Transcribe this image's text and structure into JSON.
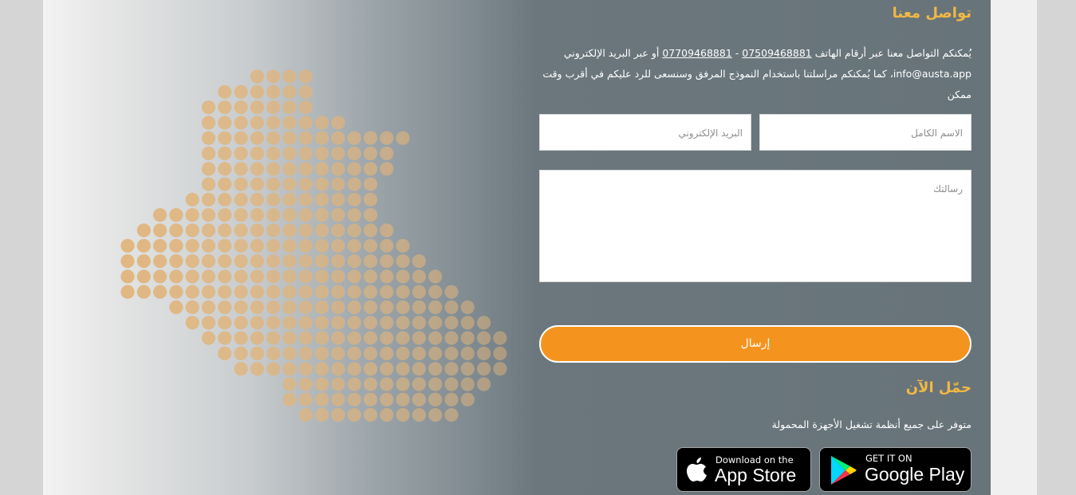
{
  "contact": {
    "title": "تواصل معنا",
    "desc_prefix": "يُمكنكم التواصل معنا عبر أرقام الهاتف ",
    "phone1": "07509468881",
    "separator": " - ",
    "phone2": "07709468881",
    "desc_middle": " أو عبر البريد الإلكتروني ",
    "email": "info@austa.app",
    "desc_suffix": "، كما يُمكنكم مراسلتنا باستخدام النموذج المرفق وسنسعى للرد عليكم في أقرب وقت ممكن"
  },
  "form": {
    "name_placeholder": "الاسم الكامل",
    "email_placeholder": "البريد الإلكتروني",
    "message_placeholder": "رسالتك",
    "send_label": "إرسال"
  },
  "download": {
    "title": "حمّل الآن",
    "subtitle": "متوفر على جميع أنظمة تشغيل الأجهزة المحمولة",
    "appstore_small": "Download on the",
    "appstore_big": "App Store",
    "gplay_small": "GET IT ON",
    "gplay_big": "Google Play"
  },
  "colors": {
    "accent": "#f2b844",
    "button": "#f4941e",
    "panel": "#67747a",
    "map_dot": "#e0b47c"
  },
  "icons": [
    "apple-icon",
    "google-play-icon"
  ]
}
